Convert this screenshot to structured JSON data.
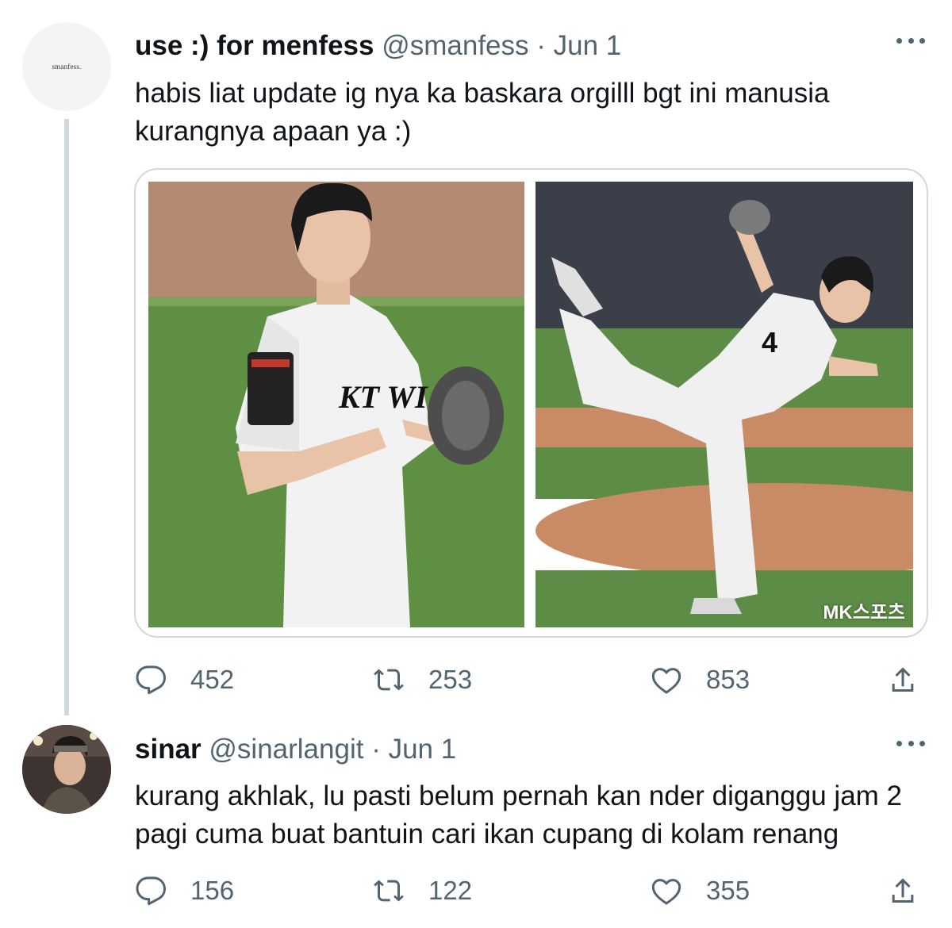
{
  "tweet": {
    "avatar_text": "smanfess.",
    "name": "use :) for menfess",
    "handle": "@smanfess",
    "separator": "·",
    "date": "Jun 1",
    "text": "habis liat update ig nya ka baskara orgilll bgt ini manusia kurangnya apaan ya :)",
    "media": {
      "watermark": "MK스포츠"
    },
    "replies": "452",
    "retweets": "253",
    "likes": "853"
  },
  "reply": {
    "name": "sinar",
    "handle": "@sinarlangit",
    "separator": "·",
    "date": "Jun 1",
    "text": "kurang akhlak, lu pasti belum pernah kan nder diganggu jam 2 pagi cuma buat bantuin cari ikan cupang di kolam renang",
    "replies": "156",
    "retweets": "122",
    "likes": "355"
  },
  "icons": [
    "more-icon",
    "reply-icon",
    "retweet-icon",
    "like-icon",
    "share-icon"
  ],
  "colors": {
    "text": "#0f1419",
    "secondary": "#536471",
    "border": "#cfd9de",
    "thread_line": "#cfd9de"
  }
}
